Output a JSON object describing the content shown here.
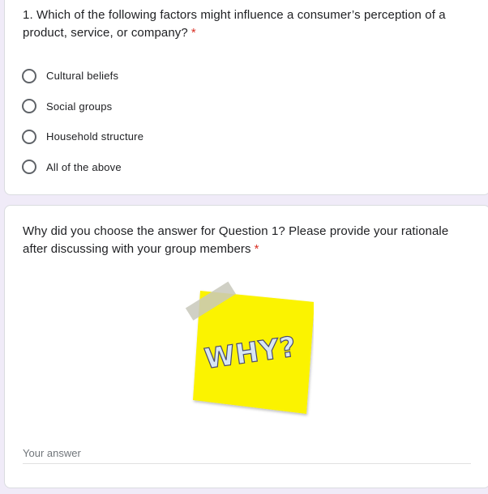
{
  "question1": {
    "title": "1. Which of the following factors might influence a consumer’s perception of a product, service, or company?",
    "required_marker": "*",
    "options": [
      {
        "label": "Cultural beliefs"
      },
      {
        "label": "Social groups"
      },
      {
        "label": "Household structure"
      },
      {
        "label": "All of the above"
      }
    ]
  },
  "question2": {
    "title": "Why did you choose the answer for Question 1? Please provide your rationale after discussing with your group members",
    "required_marker": "*",
    "image": {
      "sticky_text": "WHY?",
      "colors": {
        "note": "#fbf300",
        "tape": "#c8c8bb",
        "text_fill": "#d7e6f3",
        "text_stroke": "#4a4a70"
      }
    },
    "answer_placeholder": "Your answer"
  },
  "colors": {
    "background": "#f0ebf8",
    "card": "#ffffff",
    "required": "#d93025",
    "radio_border": "#5f6368"
  }
}
